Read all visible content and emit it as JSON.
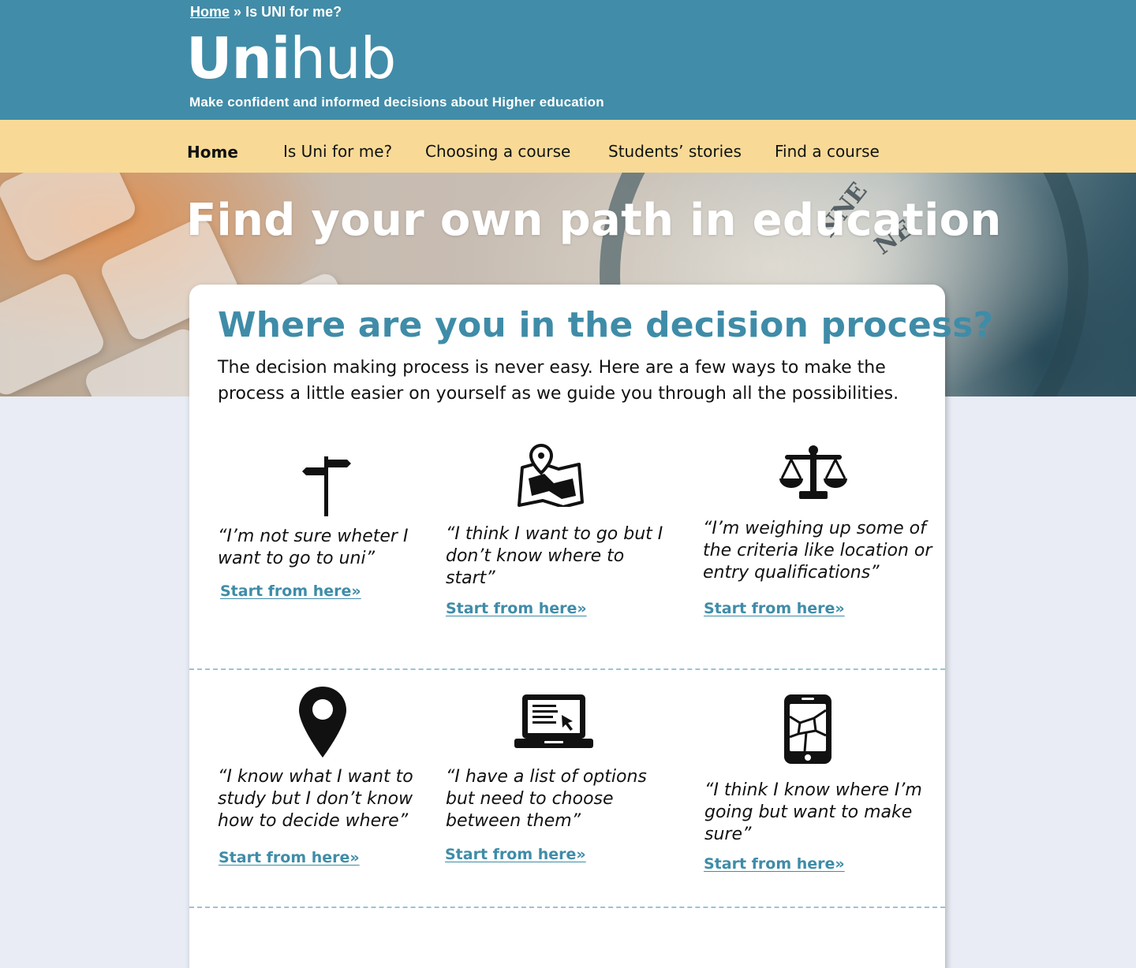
{
  "breadcrumb": {
    "home": "Home",
    "separator": "»",
    "current": "Is UNI for me?"
  },
  "brand": {
    "bold": "Uni",
    "light": "hub",
    "tagline": "Make confident and informed decisions about Higher education"
  },
  "nav": [
    "Home",
    "Is Uni for me?",
    "Choosing a course",
    "Students’ stories",
    "Find a course"
  ],
  "hero": {
    "title": "Find your own path in education",
    "compass_labels": [
      "NNE",
      "NE"
    ]
  },
  "card": {
    "title": "Where are you in the decision process?",
    "intro": "The decision making process is never easy.  Here are a few ways to make the process a little easier on yourself as we guide you through all the possibilities."
  },
  "options": [
    {
      "icon": "signpost-icon",
      "quote": "“I’m not sure wheter I want to go to uni”",
      "link": "Start from here»"
    },
    {
      "icon": "map-icon",
      "quote": "“I think I want to go but I don’t know where to start”",
      "link": "Start from here»"
    },
    {
      "icon": "scales-icon",
      "quote": "“I’m weighing up some of the criteria like location or entry qualifications”",
      "link": "Start from here»"
    },
    {
      "icon": "location-pin-icon",
      "quote": "“I know what I want to study but I don’t know how to decide where”",
      "link": "Start from here»"
    },
    {
      "icon": "laptop-icon",
      "quote": "“I have a list of options but need to choose between them”",
      "link": "Start from here»"
    },
    {
      "icon": "smartphone-map-icon",
      "quote": "“I think I know where I’m going but want to make sure”",
      "link": "Start from here»"
    }
  ],
  "colors": {
    "header": "#418ca8",
    "nav": "#f8da96",
    "accent": "#3f8ca8",
    "page_bg": "#e9ecf5"
  }
}
